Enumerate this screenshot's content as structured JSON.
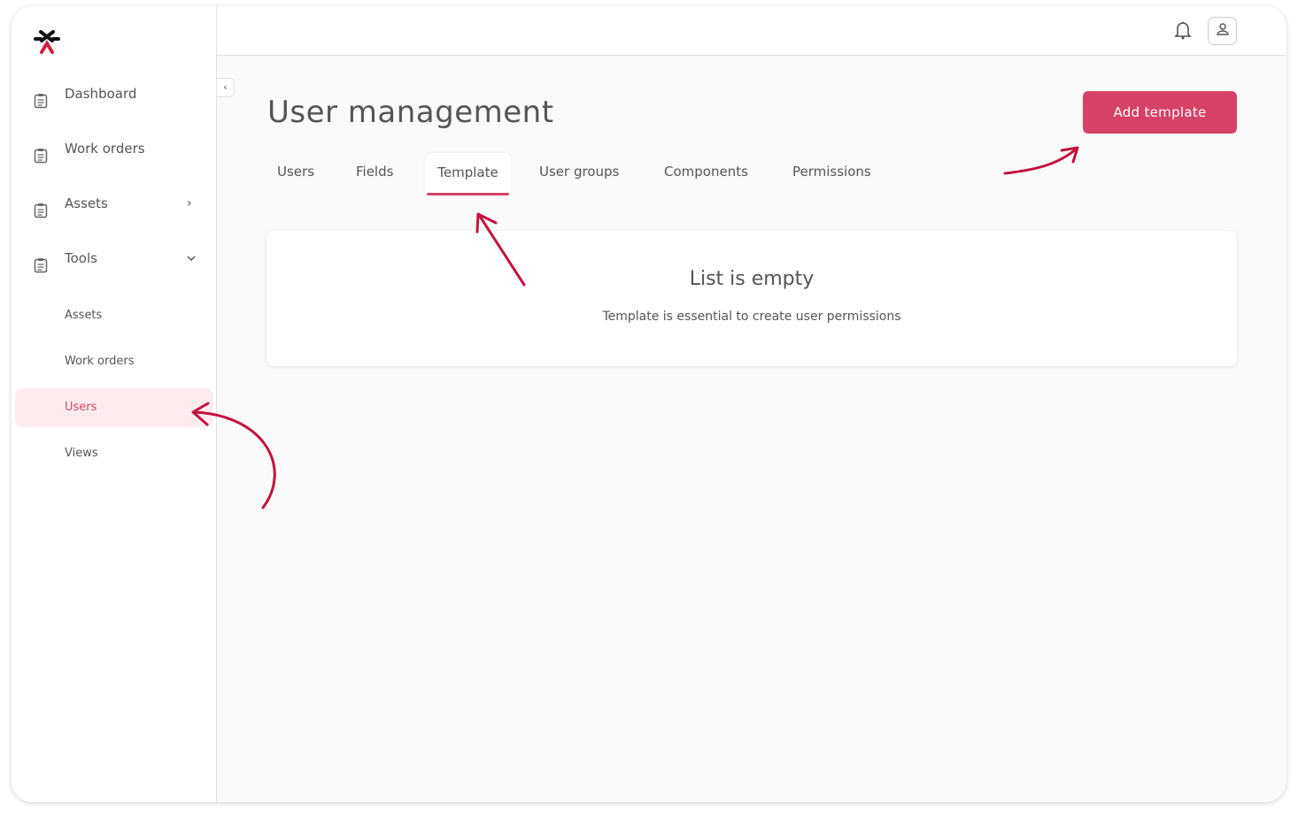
{
  "sidebar": {
    "items": [
      {
        "label": "Dashboard"
      },
      {
        "label": "Work orders"
      },
      {
        "label": "Assets"
      },
      {
        "label": "Tools"
      }
    ],
    "sub_items": [
      {
        "label": "Assets"
      },
      {
        "label": "Work orders"
      },
      {
        "label": "Users"
      },
      {
        "label": "Views"
      }
    ]
  },
  "main": {
    "title": "User management",
    "add_button": "Add template",
    "tabs": [
      {
        "label": "Users"
      },
      {
        "label": "Fields"
      },
      {
        "label": "Template"
      },
      {
        "label": "User groups"
      },
      {
        "label": "Components"
      },
      {
        "label": "Permissions"
      }
    ],
    "empty": {
      "title": "List is empty",
      "subtitle": "Template is essential to create user permissions"
    }
  },
  "colors": {
    "accent": "#d64267",
    "annotation": "#c4123f"
  }
}
